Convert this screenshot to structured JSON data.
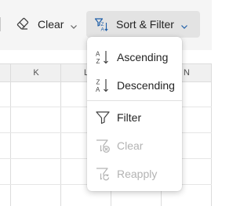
{
  "toolbar": {
    "clear_label": "Clear",
    "sort_filter_label": "Sort & Filter",
    "icons": {
      "clear": "eraser-icon",
      "sort_filter": "sort-filter-icon",
      "chevron": "chevron-down-icon"
    }
  },
  "grid": {
    "columns": [
      "K",
      "L",
      "N"
    ]
  },
  "menu": {
    "items": [
      {
        "label": "Ascending",
        "icon": "sort-ascending-icon",
        "enabled": true
      },
      {
        "label": "Descending",
        "icon": "sort-descending-icon",
        "enabled": true
      },
      {
        "label": "Filter",
        "icon": "filter-icon",
        "enabled": true
      },
      {
        "label": "Clear",
        "icon": "clear-filter-icon",
        "enabled": false
      },
      {
        "label": "Reapply",
        "icon": "reapply-filter-icon",
        "enabled": false
      }
    ]
  },
  "colors": {
    "accent": "#1f5fa8",
    "disabled": "#b3b3b3",
    "toolbar_bg": "#f5f5f5",
    "active_button_bg": "#e3e3e3"
  }
}
